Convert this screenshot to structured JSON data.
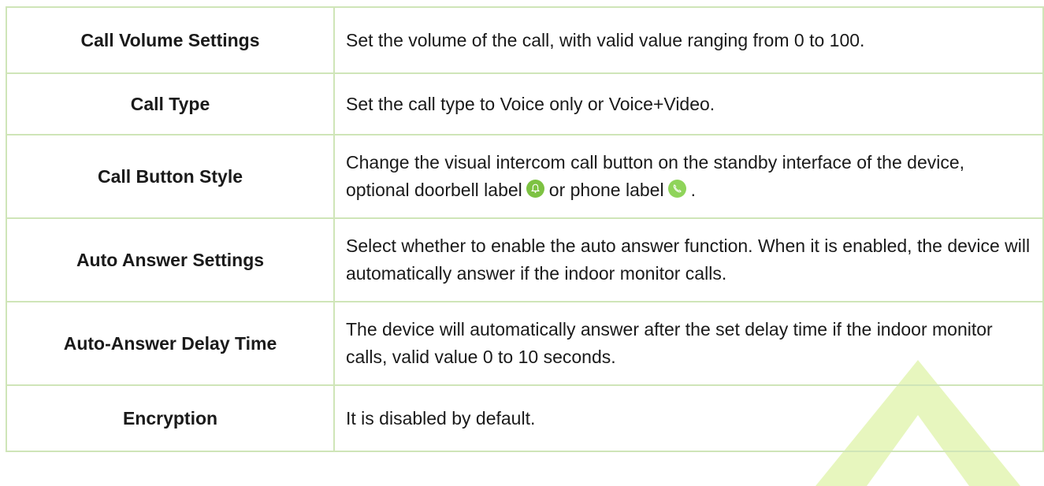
{
  "rows": [
    {
      "term": "Call Volume Settings",
      "description": "Set the volume of the call, with valid value ranging from 0 to 100."
    },
    {
      "term": "Call Type",
      "description": "Set the call type to Voice only or Voice+Video."
    },
    {
      "term": "Call Button Style",
      "description_part1": "Change the visual intercom call button on the standby interface of the device, optional doorbell label",
      "description_part2": "or phone label",
      "description_part3": "."
    },
    {
      "term": "Auto Answer Settings",
      "description": "Select whether to enable the auto answer function. When it is enabled, the device will automatically answer if the indoor monitor calls."
    },
    {
      "term": "Auto-Answer Delay Time",
      "description": "The device will automatically answer after the set delay time if the indoor monitor calls, valid value 0 to 10 seconds."
    },
    {
      "term": "Encryption",
      "description": "It is disabled by default."
    }
  ],
  "icons": {
    "doorbell": {
      "name": "doorbell-icon",
      "color": "#7dc242"
    },
    "phone": {
      "name": "phone-icon",
      "color": "#8fd45a"
    }
  },
  "colors": {
    "table_border": "#cfe5b8",
    "watermark": "#d4f08a"
  }
}
